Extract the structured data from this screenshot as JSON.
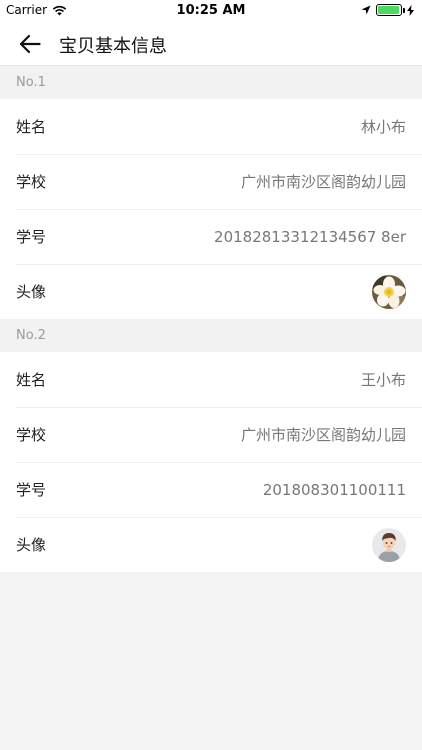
{
  "status_bar": {
    "carrier": "Carrier",
    "time": "10:25 AM",
    "battery_level": 0.95,
    "icons": [
      "wifi-icon",
      "location-arrow-icon",
      "battery-icon",
      "charging-bolt-icon"
    ]
  },
  "nav": {
    "title": "宝贝基本信息",
    "back_icon": "arrow-left-icon"
  },
  "children": [
    {
      "section_label": "No.1",
      "name_label": "姓名",
      "name": "林小布",
      "school_label": "学校",
      "school": "广州市南沙区阁韵幼儿园",
      "id_label": "学号",
      "student_id": "20182813312134567 8er",
      "avatar_label": "头像",
      "avatar": "flower-avatar"
    },
    {
      "section_label": "No.2",
      "name_label": "姓名",
      "name": "王小布",
      "school_label": "学校",
      "school": "广州市南沙区阁韵幼儿园",
      "id_label": "学号",
      "student_id": "201808301100111",
      "avatar_label": "头像",
      "avatar": "boy-avatar"
    }
  ],
  "colors": {
    "background": "#f4f4f4",
    "section_text": "#9b9b9b",
    "value_text": "#777777",
    "battery": "#4cd964"
  }
}
